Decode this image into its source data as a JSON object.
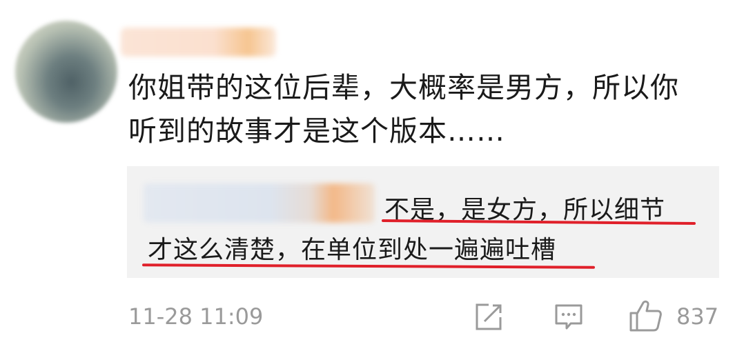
{
  "comment": {
    "text_line1": "你姐带的这位后辈，大概率是男方，所以你",
    "text_line2": "听到的故事才是这个版本……",
    "reply": {
      "line1": "不是，是女方，所以细节",
      "line2": "才这么清楚，在单位到处一遍遍吐槽",
      "underline_color": "#e0202a"
    },
    "timestamp": "11-28 11:09",
    "like_count": "837"
  },
  "icons": {
    "share": "share-icon",
    "comment": "comment-icon",
    "like": "thumbs-up-icon"
  }
}
